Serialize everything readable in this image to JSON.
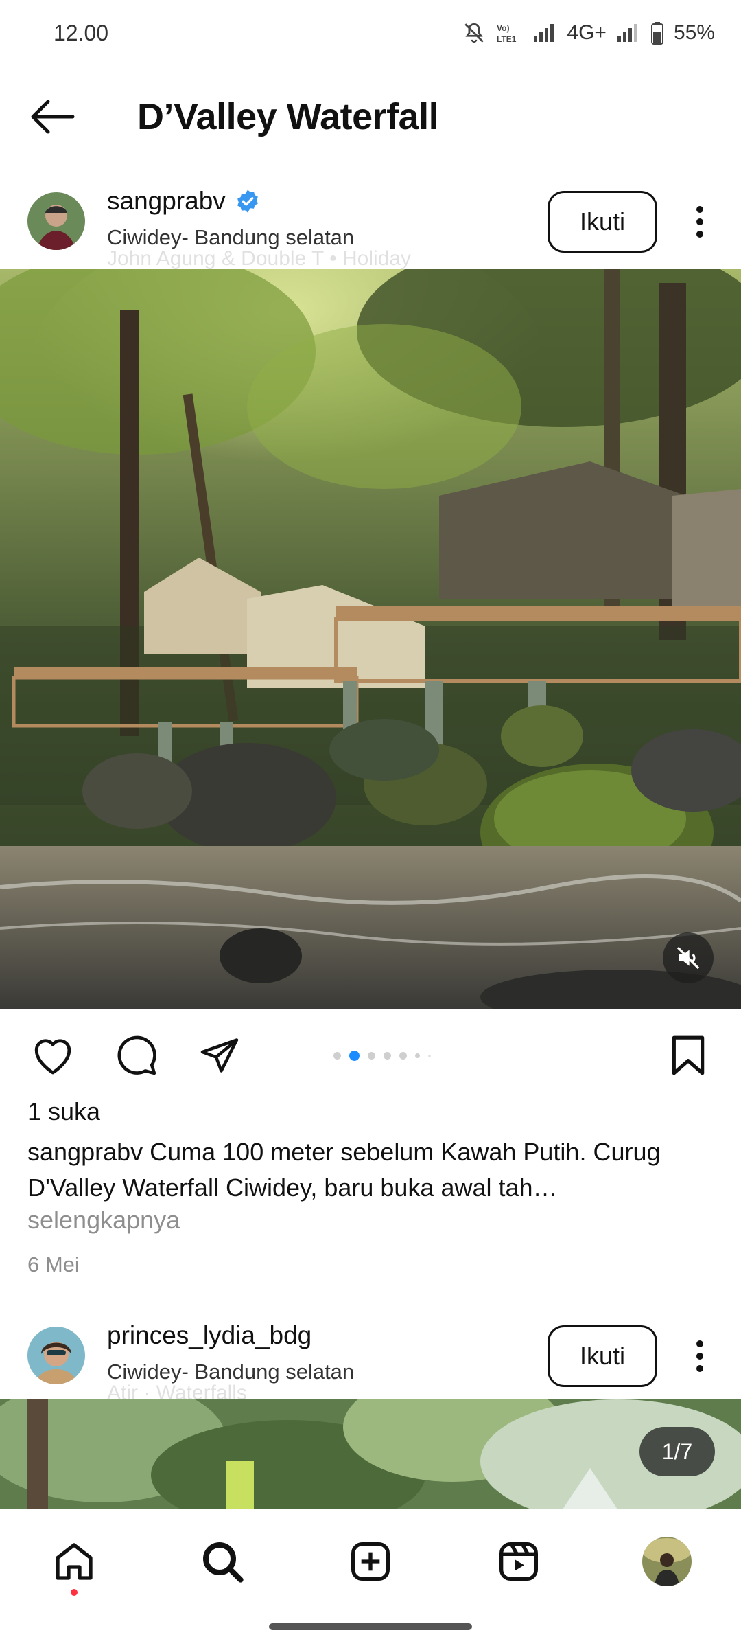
{
  "status_bar": {
    "time": "12.00",
    "network": "4G+",
    "battery": "55%",
    "icons": [
      "mute-icon",
      "volte-icon",
      "signal-icon",
      "signal-icon",
      "battery-icon"
    ]
  },
  "header": {
    "title": "D’Valley Waterfall",
    "back_icon": "arrow-left-icon"
  },
  "post1": {
    "username": "sangprabv",
    "verified": true,
    "location": "Ciwidey- Bandung selatan",
    "music_overlay": "John Agung & Double T • Holiday",
    "follow_label": "Ikuti",
    "likes": "1 suka",
    "caption_user": "sangprabv",
    "caption_text": " Cuma 100 meter sebelum Kawah Putih. Curug D'Valley Waterfall Ciwidey, baru buka awal tah…",
    "more_label": "selengkapnya",
    "date": "6 Mei",
    "carousel": {
      "count": 7,
      "active_index": 1
    }
  },
  "post2": {
    "username": "princes_lydia_bdg",
    "location": "Ciwidey- Bandung selatan",
    "music_overlay": "Atir · Waterfalls",
    "follow_label": "Ikuti",
    "counter": "1/7"
  },
  "bottom_nav": {
    "items": [
      "home-icon",
      "search-icon",
      "create-icon",
      "reels-icon",
      "profile-avatar"
    ]
  },
  "colors": {
    "accent_blue": "#1a8cff",
    "verified_blue": "#3897f0",
    "notification_red": "#ff3040",
    "muted_text": "#8e8e8e"
  }
}
